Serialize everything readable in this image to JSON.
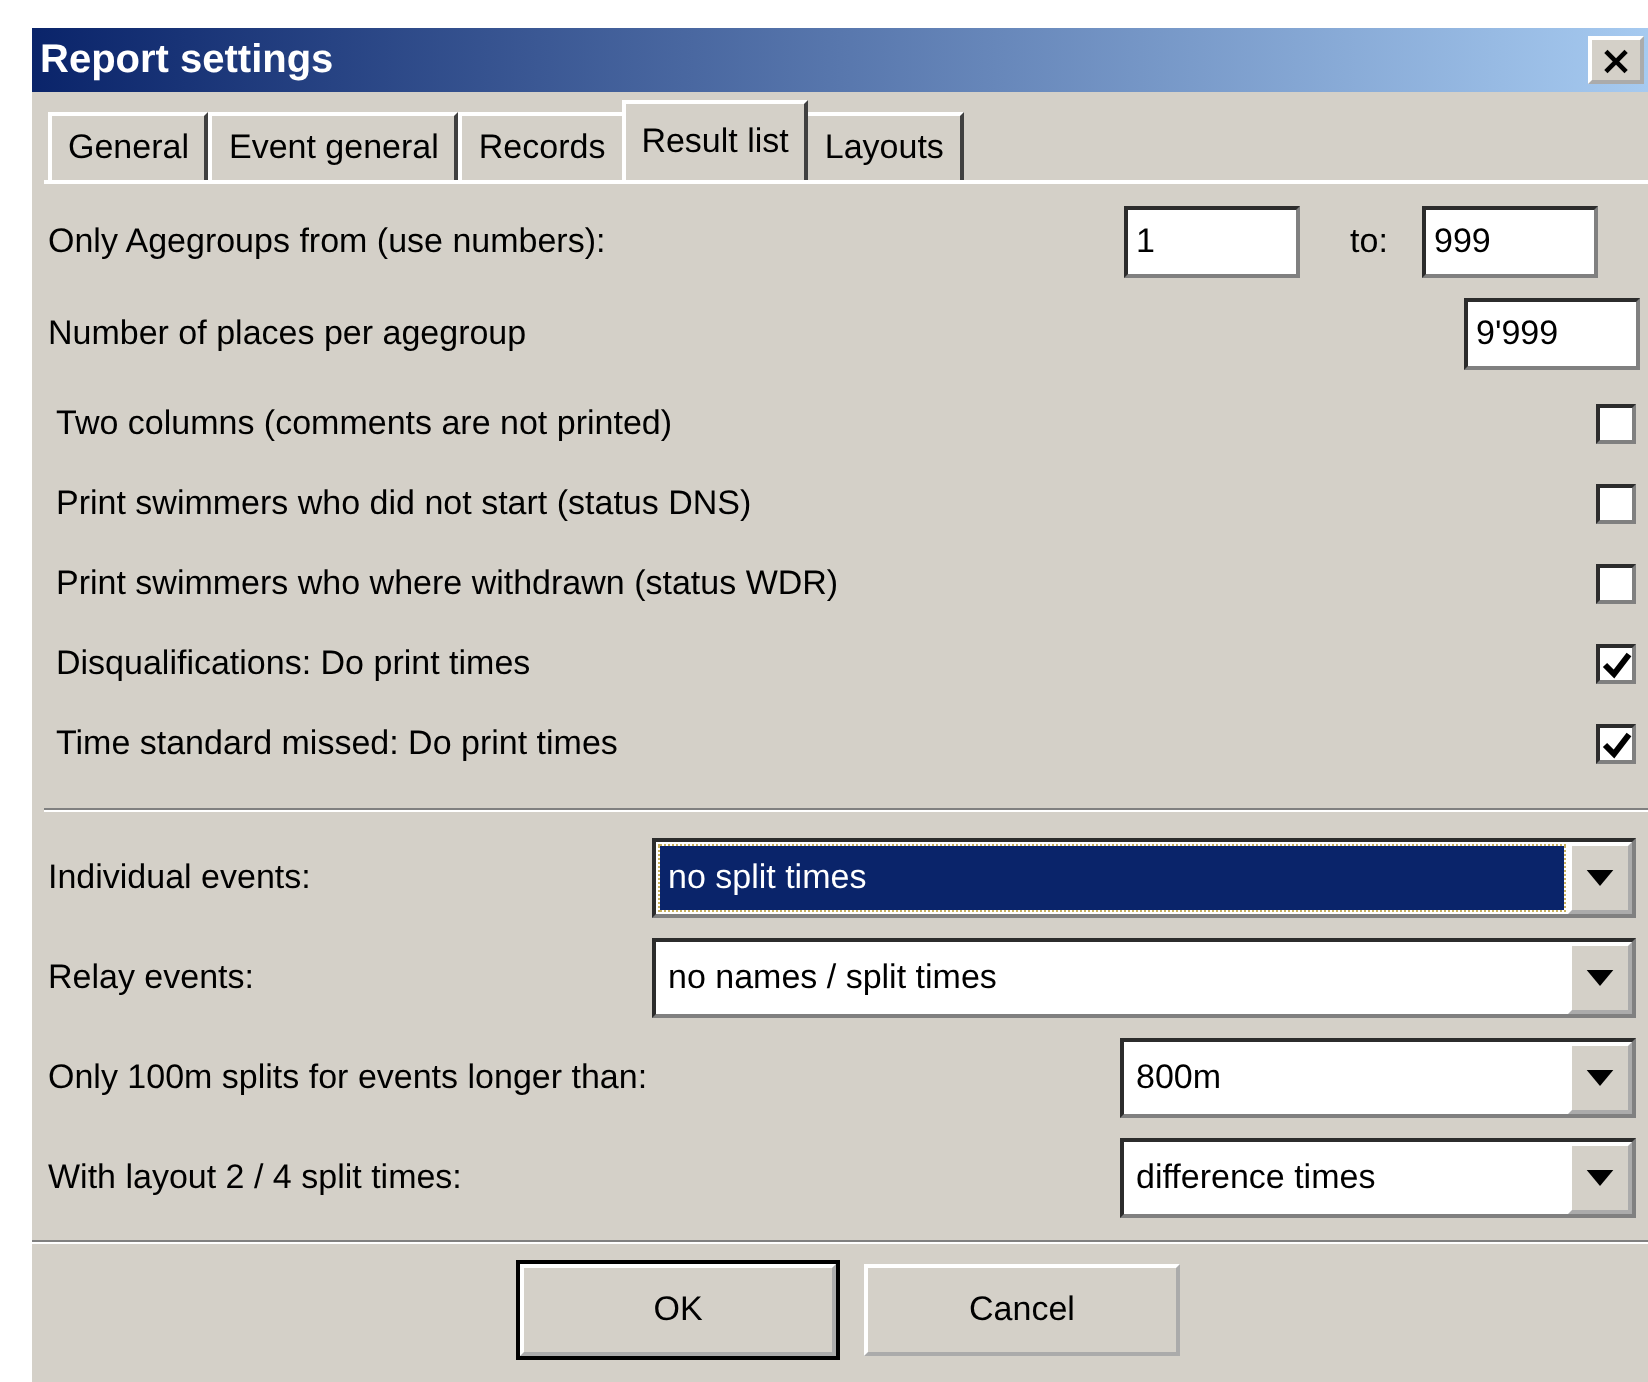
{
  "window": {
    "title": "Report settings",
    "close": "×"
  },
  "tabs": [
    {
      "label": "General",
      "selected": false
    },
    {
      "label": "Event general",
      "selected": false
    },
    {
      "label": "Records",
      "selected": false
    },
    {
      "label": "Result list",
      "selected": true
    },
    {
      "label": "Layouts",
      "selected": false
    }
  ],
  "agegroups": {
    "label": "Only Agegroups from (use numbers):",
    "from": "1",
    "to_label": "to:",
    "to": "999"
  },
  "places": {
    "label": "Number of places per agegroup",
    "value": "9'999"
  },
  "options": [
    {
      "label": "Two columns (comments are not printed)",
      "checked": false
    },
    {
      "label": "Print swimmers who did not start (status DNS)",
      "checked": false
    },
    {
      "label": "Print swimmers who where withdrawn (status WDR)",
      "checked": false
    },
    {
      "label": "Disqualifications: Do print times",
      "checked": true
    },
    {
      "label": "Time standard missed: Do print times",
      "checked": true
    }
  ],
  "dropdowns": [
    {
      "label": "Individual events:",
      "value": "no split times",
      "kind": "wide",
      "focused": true
    },
    {
      "label": "Relay events:",
      "value": "no names / split times",
      "kind": "wide",
      "focused": false
    },
    {
      "label": "Only 100m splits for events longer than:",
      "value": "800m",
      "kind": "narrow",
      "focused": false
    },
    {
      "label": "With layout 2 / 4 split times:",
      "value": "difference times",
      "kind": "narrow",
      "focused": false
    }
  ],
  "buttons": [
    {
      "label": "OK",
      "default": true
    },
    {
      "label": "Cancel",
      "default": false
    }
  ]
}
